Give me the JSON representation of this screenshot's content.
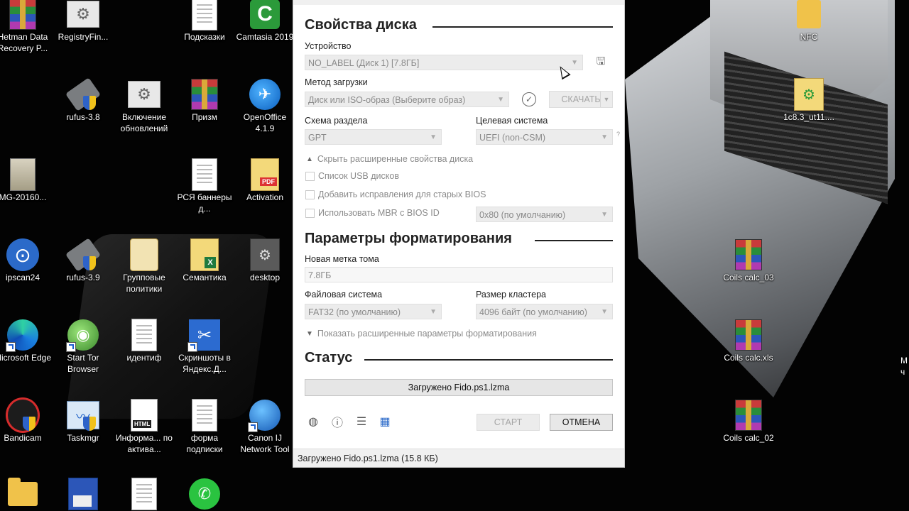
{
  "desktop": {
    "icons": [
      {
        "label": "Hetman Data Recovery P...",
        "icon": "archive-icon"
      },
      {
        "label": "RegistryFin...",
        "icon": "registry-icon"
      },
      {
        "label": "Подсказки",
        "icon": "document-icon"
      },
      {
        "label": "Camtasia 2019",
        "icon": "camtasia-icon"
      },
      {
        "label": "rufus-3.8",
        "icon": "usb-icon"
      },
      {
        "label": "Включение обновлений",
        "icon": "gear-icon"
      },
      {
        "label": "Призм",
        "icon": "archive-icon"
      },
      {
        "label": "OpenOffice 4.1.9",
        "icon": "openoffice-icon"
      },
      {
        "label": "MG-20160...",
        "icon": "photo-icon"
      },
      {
        "label": "РСЯ баннеры д...",
        "icon": "document-icon"
      },
      {
        "label": "Activation",
        "icon": "pdf-icon"
      },
      {
        "label": "ipscan24",
        "icon": "network-icon"
      },
      {
        "label": "rufus-3.9",
        "icon": "usb-icon"
      },
      {
        "label": "Групповые политики",
        "icon": "scroll-icon"
      },
      {
        "label": "Семантика",
        "icon": "excel-icon"
      },
      {
        "label": "desktop",
        "icon": "desktop-icon"
      },
      {
        "label": "Microsoft Edge",
        "icon": "edge-icon"
      },
      {
        "label": "Start Tor Browser",
        "icon": "tor-icon"
      },
      {
        "label": "идентиф",
        "icon": "document-icon"
      },
      {
        "label": "Скриншоты в Яндекс.Д...",
        "icon": "scissors-icon"
      },
      {
        "label": "Bandicam",
        "icon": "bandicam-icon"
      },
      {
        "label": "Taskmgr",
        "icon": "taskmgr-icon"
      },
      {
        "label": "Информа... по активa...",
        "icon": "html-icon"
      },
      {
        "label": "форма подписки",
        "icon": "document-icon"
      },
      {
        "label": "Canon IJ Network Tool",
        "icon": "canon-icon"
      },
      {
        "label": "NFC",
        "icon": "folder-icon"
      },
      {
        "label": "1c8.3_ut11....",
        "icon": "1c-icon"
      },
      {
        "label": "Coils calc_03",
        "icon": "archive-icon"
      },
      {
        "label": "Coils calc.xls",
        "icon": "archive-icon"
      },
      {
        "label": "Coils calc_02",
        "icon": "archive-icon"
      }
    ],
    "partial_right_text": "М\nч"
  },
  "rufus": {
    "drive_props_title": "Свойства диска",
    "device_label": "Устройство",
    "device_value": "NO_LABEL (Диск 1) [7.8ГБ]",
    "boot_label": "Метод загрузки",
    "boot_value": "Диск или ISO-образ (Выберите образ)",
    "download_label": "СКАЧАТЬ",
    "partition_label": "Схема раздела",
    "partition_value": "GPT",
    "target_label": "Целевая система",
    "target_value": "UEFI (non-CSM)",
    "target_help": "?",
    "hide_advanced": "Скрыть расширенные свойства диска",
    "list_usb": "Список USB дисков",
    "old_bios": "Добавить исправления для старых BIOS",
    "use_mbr": "Использовать MBR с BIOS ID",
    "bios_id_value": "0x80 (по умолчанию)",
    "format_title": "Параметры форматирования",
    "volume_label": "Новая метка тома",
    "volume_value": "7.8ГБ",
    "fs_label": "Файловая система",
    "fs_value": "FAT32 (по умолчанию)",
    "cluster_label": "Размер кластера",
    "cluster_value": "4096 байт (по умолчанию)",
    "show_advanced_format": "Показать расширенные параметры форматирования",
    "status_title": "Статус",
    "progress_text": "Загружено Fido.ps1.lzma",
    "start_label": "СТАРТ",
    "cancel_label": "ОТМЕНА",
    "statusbar_text": "Загружено Fido.ps1.lzma (15.8 КБ)"
  }
}
